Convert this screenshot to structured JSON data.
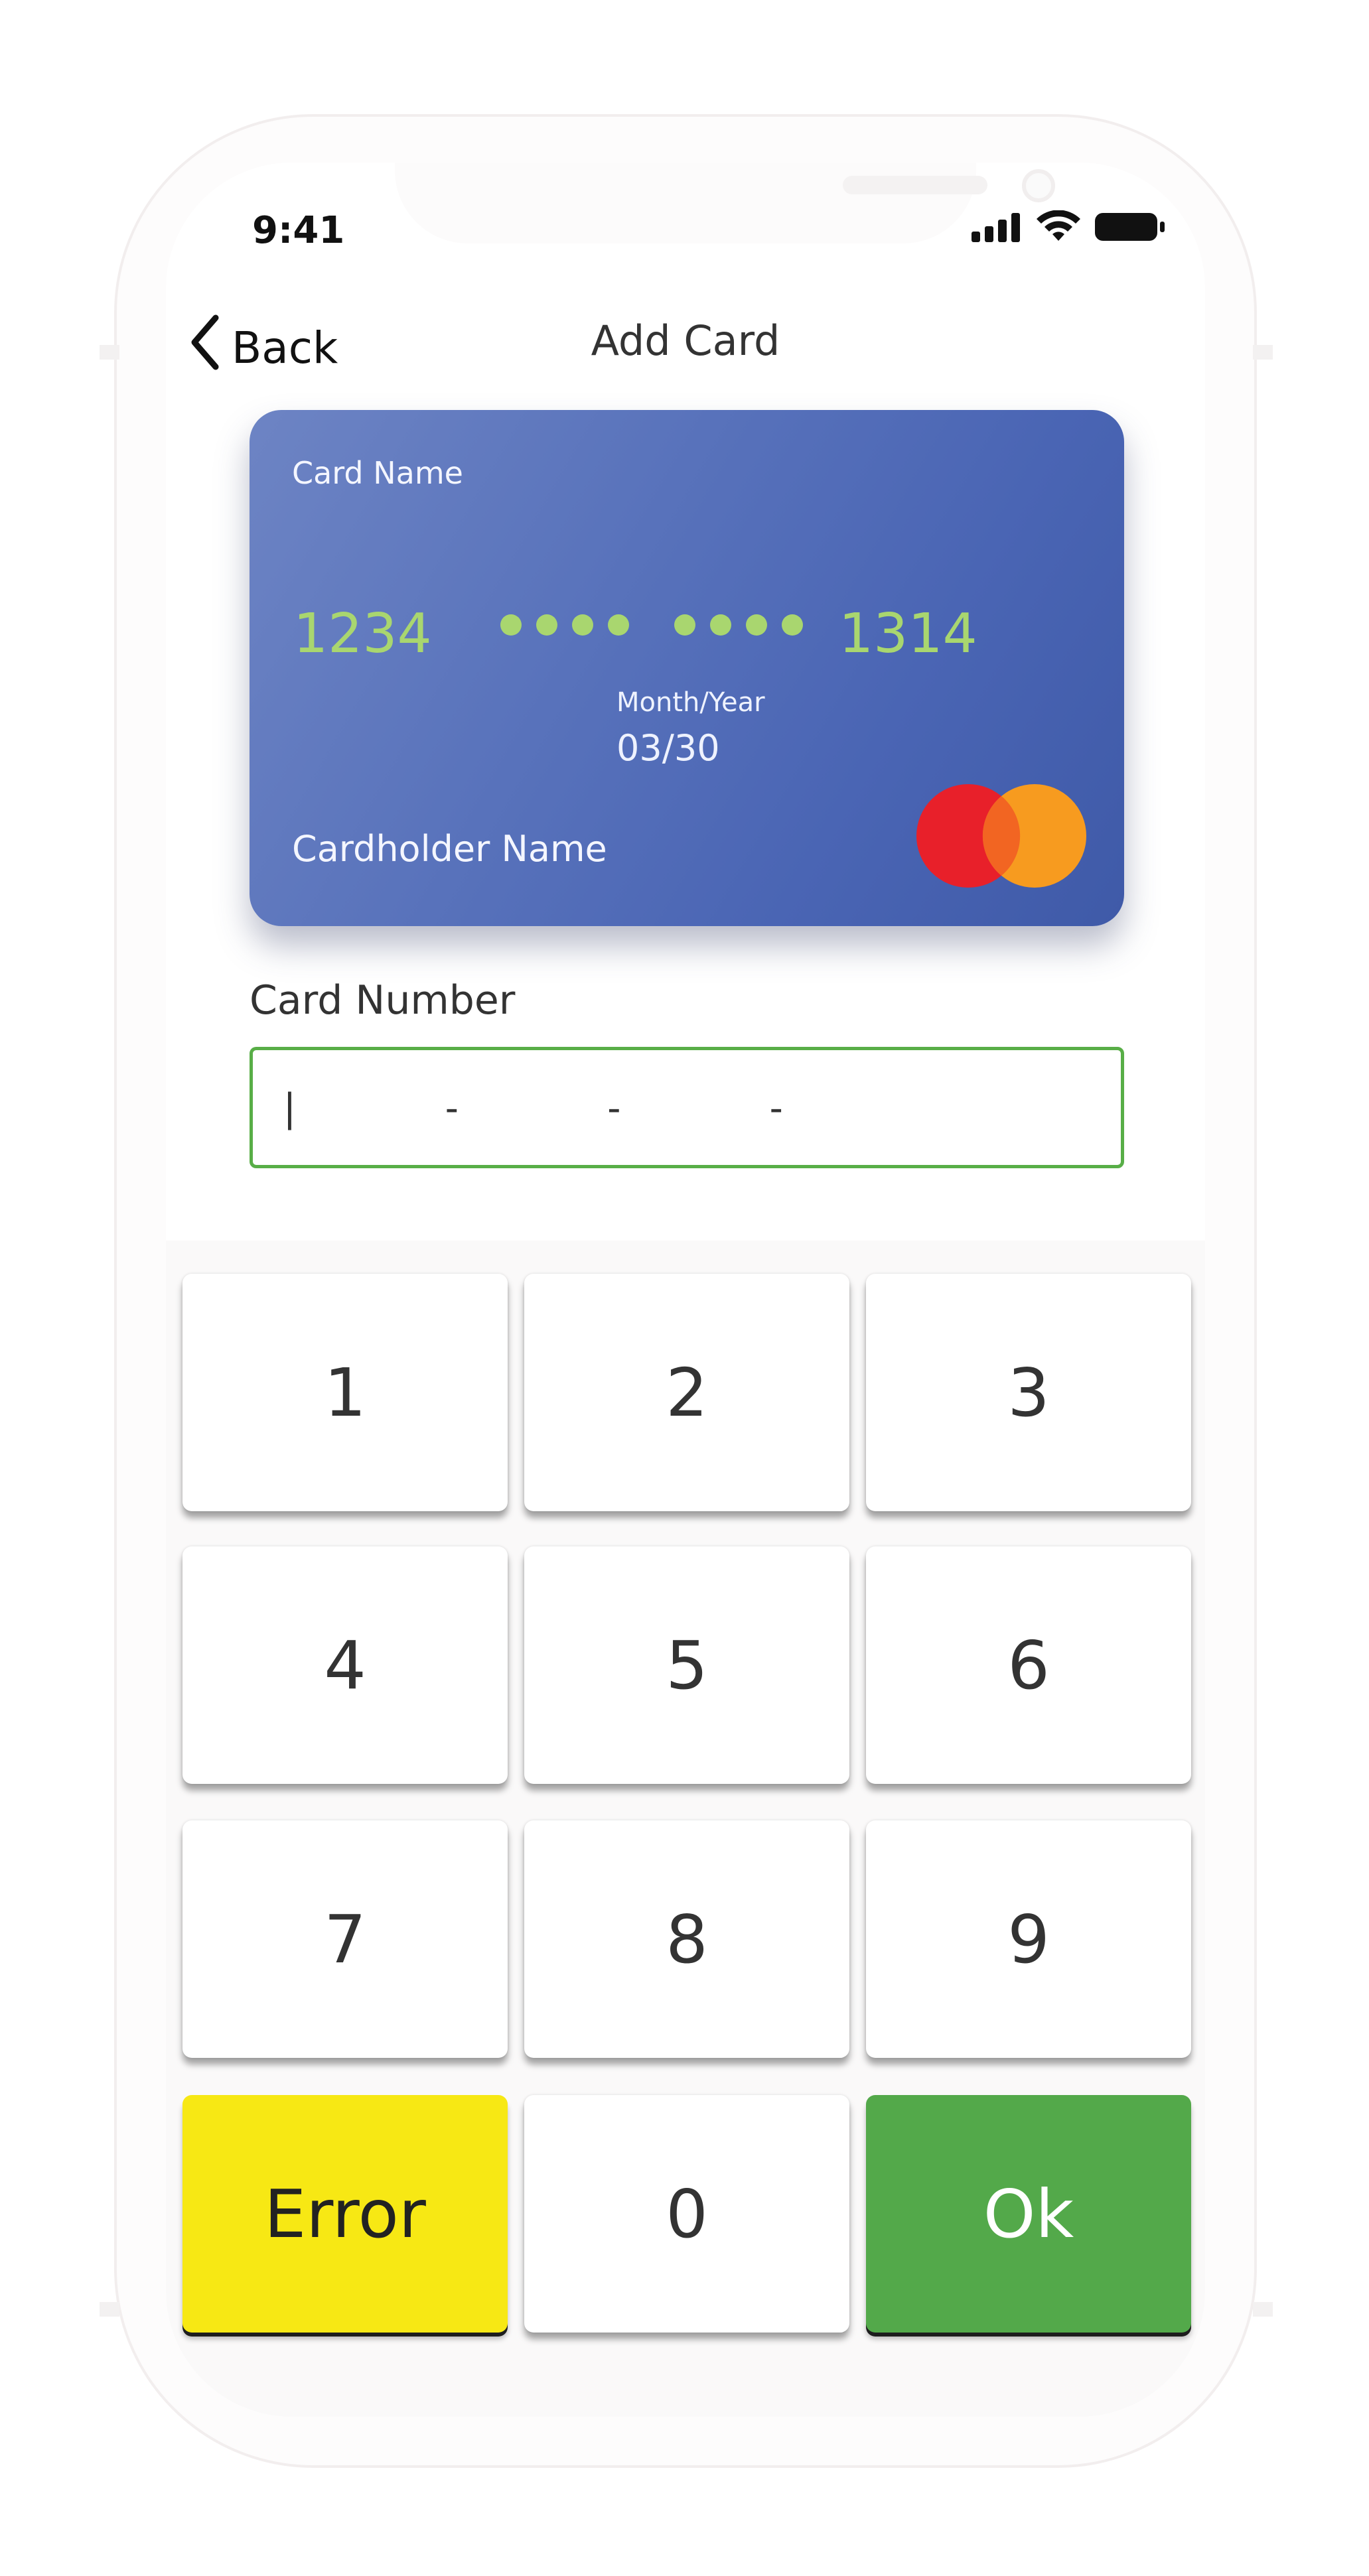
{
  "status_bar": {
    "time": "9:41"
  },
  "nav": {
    "back_label": "Back",
    "title": "Add Card"
  },
  "card_preview": {
    "card_name": "Card Name",
    "number_first": "1234",
    "number_last": "1314",
    "month_year_label": "Month/Year",
    "month_year_value": "03/30",
    "holder_name": "Cardholder Name",
    "brand_icon": "mastercard-logo",
    "colors": {
      "card_gradient_start": "#6d84c4",
      "card_gradient_end": "#3f5aa8",
      "number_color": "#a9d66f"
    }
  },
  "form": {
    "card_number_label": "Card Number",
    "card_number_value": "|      -      -      -"
  },
  "keypad": {
    "keys": [
      "1",
      "2",
      "3",
      "4",
      "5",
      "6",
      "7",
      "8",
      "9"
    ],
    "error_label": "Error",
    "zero_label": "0",
    "ok_label": "Ok",
    "colors": {
      "error": "#f7e814",
      "ok": "#53a94a",
      "input_border": "#58ae47"
    }
  }
}
